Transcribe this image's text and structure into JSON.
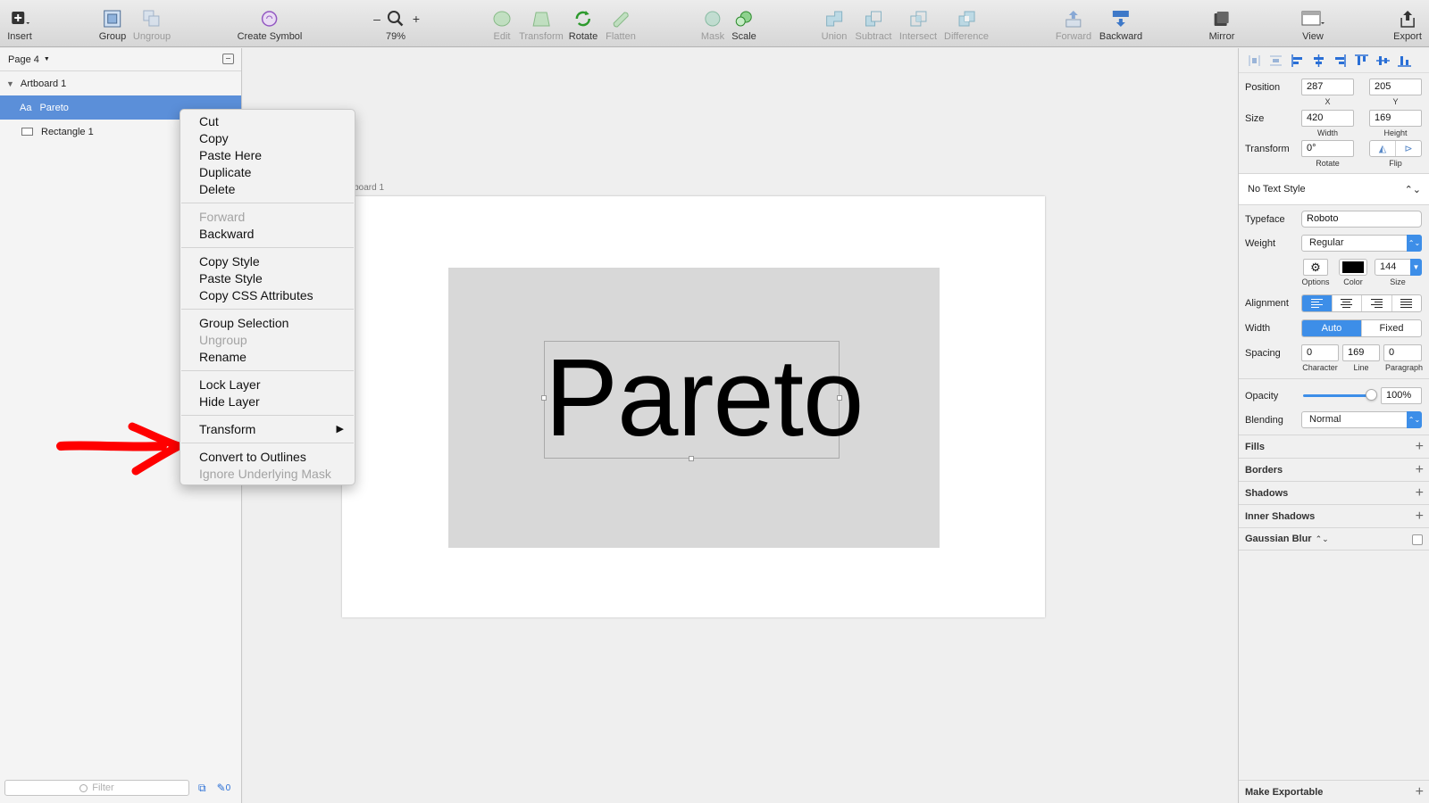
{
  "toolbar": {
    "insert": "Insert",
    "group": "Group",
    "ungroup": "Ungroup",
    "create_symbol": "Create Symbol",
    "zoom_minus": "–",
    "zoom_plus": "+",
    "zoom": "79%",
    "edit": "Edit",
    "transform": "Transform",
    "rotate": "Rotate",
    "flatten": "Flatten",
    "mask": "Mask",
    "scale": "Scale",
    "union": "Union",
    "subtract": "Subtract",
    "intersect": "Intersect",
    "difference": "Difference",
    "forward": "Forward",
    "backward": "Backward",
    "mirror": "Mirror",
    "view": "View",
    "export": "Export"
  },
  "layers": {
    "page": "Page 4",
    "artboard": "Artboard 1",
    "text_layer_icon": "Aa",
    "text_layer": "Pareto",
    "rect_layer": "Rectangle 1",
    "filter_placeholder": "Filter",
    "filter_count": "0"
  },
  "canvas": {
    "artboard_label": "rtboard 1",
    "text": "Pareto"
  },
  "menu": {
    "group1": [
      "Cut",
      "Copy",
      "Paste Here",
      "Duplicate",
      "Delete"
    ],
    "forward": "Forward",
    "backward": "Backward",
    "group3": [
      "Copy Style",
      "Paste Style",
      "Copy CSS Attributes"
    ],
    "group_selection": "Group Selection",
    "ungroup": "Ungroup",
    "rename": "Rename",
    "group5": [
      "Lock Layer",
      "Hide Layer"
    ],
    "transform": "Transform",
    "convert": "Convert to Outlines",
    "ignore_mask": "Ignore Underlying Mask"
  },
  "inspector": {
    "position_label": "Position",
    "x": "287",
    "y": "205",
    "x_cap": "X",
    "y_cap": "Y",
    "size_label": "Size",
    "width": "420",
    "height": "169",
    "width_cap": "Width",
    "height_cap": "Height",
    "transform_label": "Transform",
    "rotate": "0°",
    "rotate_cap": "Rotate",
    "flip_cap": "Flip",
    "text_style": "No Text Style",
    "typeface_label": "Typeface",
    "typeface": "Roboto",
    "weight_label": "Weight",
    "weight": "Regular",
    "options_cap": "Options",
    "color_cap": "Color",
    "size_cap": "Size",
    "font_size": "144",
    "alignment_label": "Alignment",
    "width_mode_label": "Width",
    "auto": "Auto",
    "fixed": "Fixed",
    "spacing_label": "Spacing",
    "character": "0",
    "line": "169",
    "paragraph": "0",
    "character_cap": "Character",
    "line_cap": "Line",
    "paragraph_cap": "Paragraph",
    "opacity_label": "Opacity",
    "opacity": "100%",
    "blending_label": "Blending",
    "blending": "Normal",
    "fills": "Fills",
    "borders": "Borders",
    "shadows": "Shadows",
    "inner_shadows": "Inner Shadows",
    "gaussian_blur": "Gaussian Blur",
    "make_exportable": "Make Exportable"
  },
  "colors": {
    "selection": "#5b8fd9",
    "accent": "#3d8ee8",
    "annotation_arrow": "#ff0000",
    "text_color": "#000000"
  }
}
